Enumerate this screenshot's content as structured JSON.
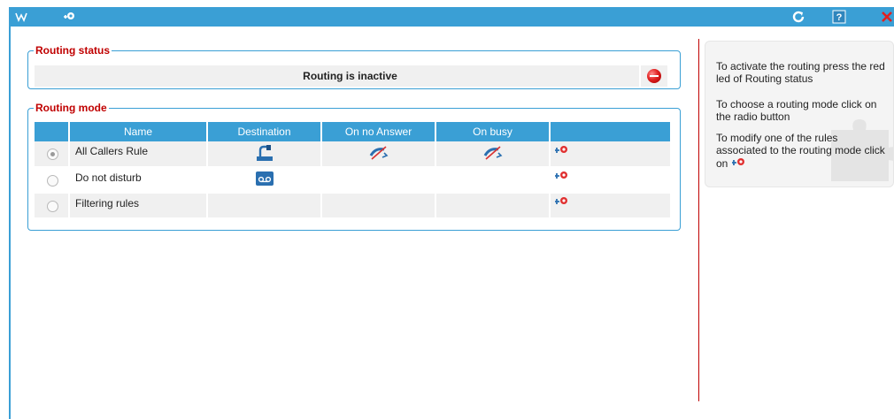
{
  "app": {
    "toolbar_icons": [
      "routing-logo-icon",
      "rules-icon"
    ],
    "window_actions": [
      "refresh-icon",
      "help-icon",
      "close-icon"
    ],
    "colors": {
      "accent": "#3a9fd5",
      "legend": "#c00000",
      "led": "#e02020"
    }
  },
  "routing_status": {
    "legend": "Routing status",
    "text": "Routing is inactive",
    "led_icon": "red-led-icon"
  },
  "routing_mode": {
    "legend": "Routing mode",
    "columns": [
      "",
      "Name",
      "Destination",
      "On no Answer",
      "On busy",
      ""
    ],
    "rows": [
      {
        "name": "All Callers Rule",
        "selected": true,
        "destination": "desk-phone-icon",
        "on_no_answer": "forward-phone-icon",
        "on_busy": "forward-phone-icon",
        "action": "rule-edit-icon"
      },
      {
        "name": "Do not disturb",
        "selected": false,
        "destination": "voicemail-icon",
        "on_no_answer": "",
        "on_busy": "",
        "action": "rule-edit-icon"
      },
      {
        "name": "Filtering rules",
        "selected": false,
        "destination": "",
        "on_no_answer": "",
        "on_busy": "",
        "action": "rule-edit-icon"
      }
    ]
  },
  "help_panel": {
    "line1": "To activate the routing press the red led of Routing status",
    "line2": "To choose a routing mode click on the radio button",
    "line3": "To modify one of the rules associated to the routing mode click on"
  }
}
